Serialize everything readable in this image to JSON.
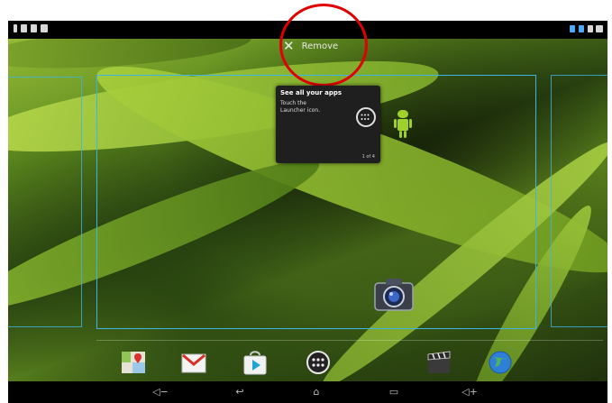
{
  "remove_bar": {
    "label": "Remove"
  },
  "cling": {
    "title": "See all your apps",
    "body": "Touch the Launcher icon.",
    "page": "1 of 4"
  },
  "dock": {
    "items": [
      "maps-icon",
      "gmail-icon",
      "play-store-icon",
      "all-apps-icon",
      "video-icon",
      "browser-icon"
    ]
  },
  "navbar": {
    "buttons": [
      "volume-down-icon",
      "back-icon",
      "home-icon",
      "recent-apps-icon",
      "volume-up-icon"
    ]
  },
  "colors": {
    "highlight_ring": "#e10000",
    "frame": "#3bb5e3",
    "statusbar": "#000000"
  }
}
